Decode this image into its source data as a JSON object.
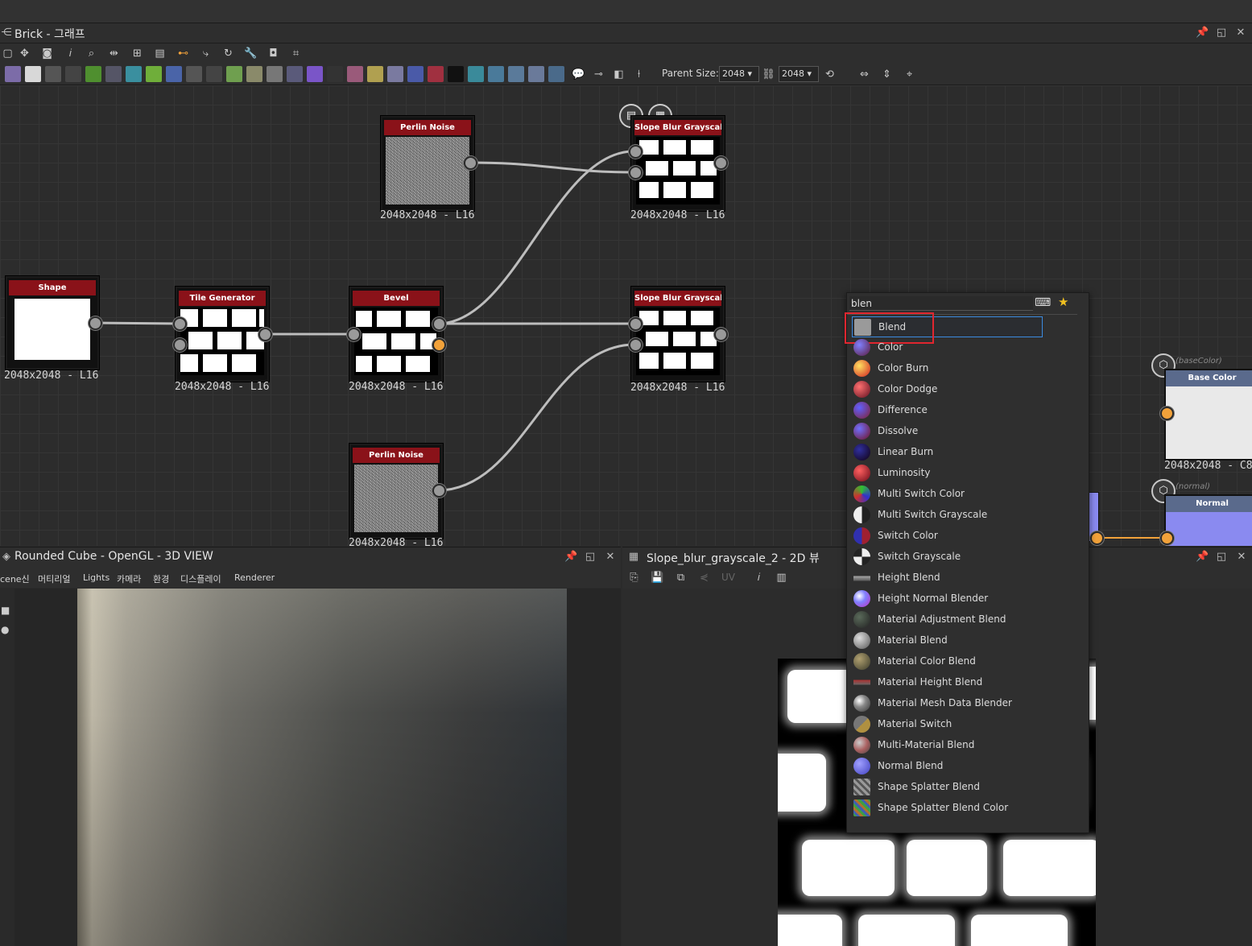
{
  "graph_window": {
    "title": "Brick - 그래프"
  },
  "toolbar": {
    "parent_size_label": "Parent Size:",
    "parent_size_value": "2048 ▾",
    "size_value_2": "2048 ▾"
  },
  "nodes": {
    "perlin_top": {
      "title": "Perlin Noise",
      "caption": "2048x2048 - L16"
    },
    "slope_top": {
      "title": "Slope Blur Grayscale",
      "caption": "2048x2048 - L16"
    },
    "shape": {
      "title": "Shape",
      "caption": "2048x2048 - L16"
    },
    "tile_generator": {
      "title": "Tile Generator",
      "caption": "2048x2048 - L16"
    },
    "bevel": {
      "title": "Bevel",
      "caption": "2048x2048 - L16"
    },
    "slope_mid": {
      "title": "Slope Blur Grayscale",
      "caption": "2048x2048 - L16"
    },
    "perlin_bottom": {
      "title": "Perlin Noise",
      "caption": "2048x2048 - L16"
    },
    "base_color": {
      "title": "Base Color",
      "tag": "(baseColor)",
      "caption": "2048x2048 - C8"
    },
    "normal": {
      "title": "Normal",
      "tag": "(normal)"
    }
  },
  "search_popup": {
    "query": "blen",
    "items": [
      {
        "label": "Blend",
        "selected": true
      },
      {
        "label": "Color"
      },
      {
        "label": "Color Burn"
      },
      {
        "label": "Color Dodge"
      },
      {
        "label": "Difference"
      },
      {
        "label": "Dissolve"
      },
      {
        "label": "Linear Burn"
      },
      {
        "label": "Luminosity"
      },
      {
        "label": "Multi Switch Color"
      },
      {
        "label": "Multi Switch Grayscale"
      },
      {
        "label": "Switch Color"
      },
      {
        "label": "Switch Grayscale"
      },
      {
        "label": "Height Blend"
      },
      {
        "label": "Height Normal Blender"
      },
      {
        "label": "Material Adjustment Blend"
      },
      {
        "label": "Material Blend"
      },
      {
        "label": "Material Color Blend"
      },
      {
        "label": "Material Height Blend"
      },
      {
        "label": "Material Mesh Data Blender"
      },
      {
        "label": "Material Switch"
      },
      {
        "label": "Multi-Material Blend"
      },
      {
        "label": "Normal Blend"
      },
      {
        "label": "Shape Splatter Blend"
      },
      {
        "label": "Shape Splatter Blend Color"
      }
    ]
  },
  "view3d": {
    "title": "Rounded Cube - OpenGL - 3D VIEW",
    "menu": [
      "cene신",
      "머티리얼",
      "Lights",
      "카메라",
      "환경",
      "디스플레이",
      "Renderer"
    ]
  },
  "view2d": {
    "title": "Slope_blur_grayscale_2 - 2D 뷰",
    "uv_label": "UV"
  }
}
